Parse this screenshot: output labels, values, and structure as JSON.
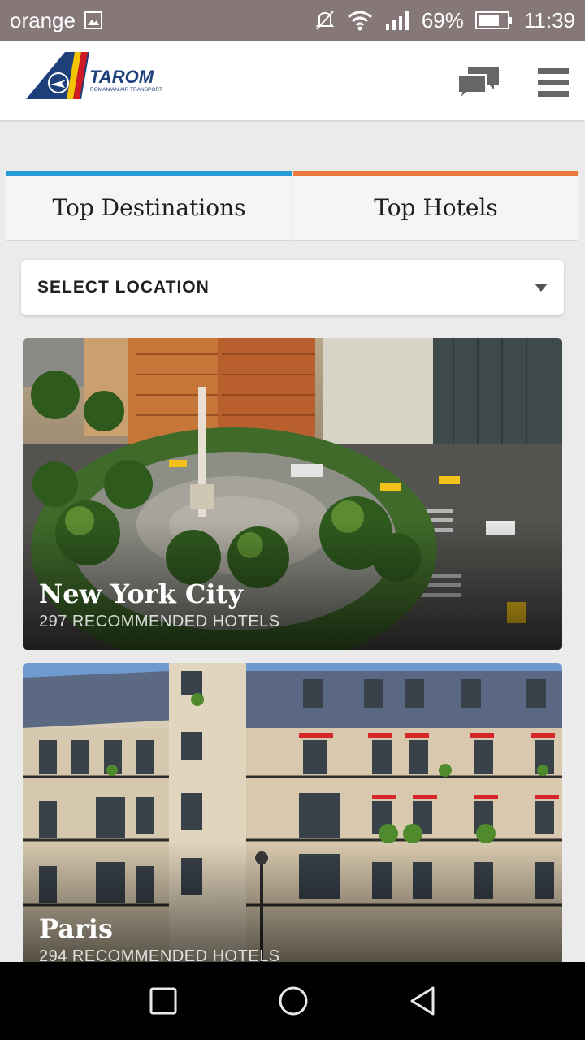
{
  "status_bar": {
    "carrier": "orange",
    "battery": "69%",
    "time": "11:39",
    "icons": [
      "image-icon",
      "mute-icon",
      "wifi-icon",
      "signal-icon",
      "battery-icon"
    ]
  },
  "header": {
    "brand": "TAROM",
    "tagline": "ROMANIAN AIR TRANSPORT",
    "icons": [
      "chat-icon",
      "menu-icon"
    ]
  },
  "tabs": [
    {
      "label": "Top Destinations",
      "accent": "#2a9ad6"
    },
    {
      "label": "Top Hotels",
      "accent": "#ec7a3a"
    }
  ],
  "location_select": {
    "label": "SELECT LOCATION"
  },
  "destinations": [
    {
      "city": "New York City",
      "hotels": "297 RECOMMENDED HOTELS"
    },
    {
      "city": "Paris",
      "hotels": "294 RECOMMENDED HOTELS"
    }
  ],
  "nav_bar": {
    "icons": [
      "recents-icon",
      "home-icon",
      "back-icon"
    ]
  }
}
